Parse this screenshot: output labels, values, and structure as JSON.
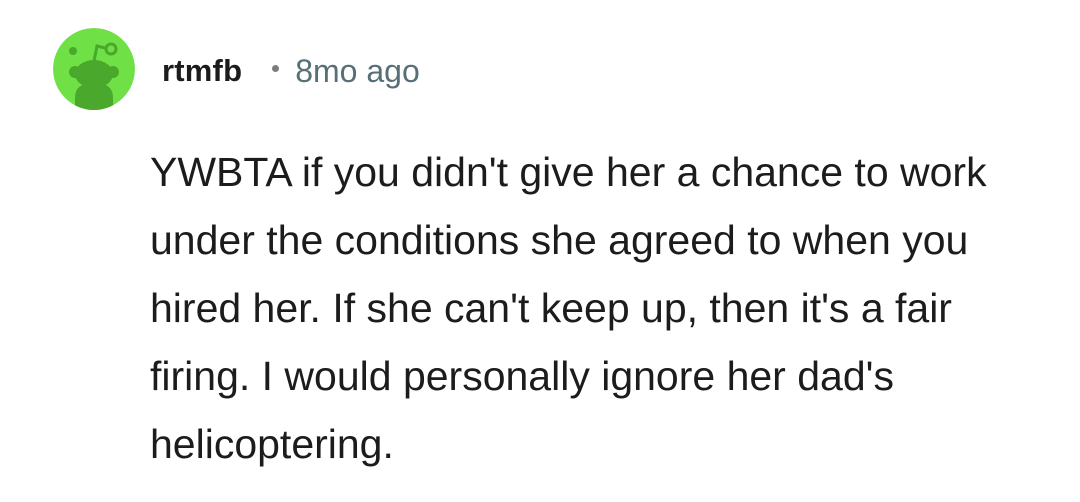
{
  "comment": {
    "avatar": {
      "icon": "reddit-snoo-avatar-icon",
      "background_color": "#6fe046",
      "figure_color": "#4aa82c"
    },
    "username": "rtmfb",
    "timestamp": "8mo ago",
    "body": "YWBTA if you didn't give her a chance to work under the conditions she agreed to when you hired her. If she can't keep up, then it's a fair firing. I would personally ignore her dad's helicoptering."
  }
}
